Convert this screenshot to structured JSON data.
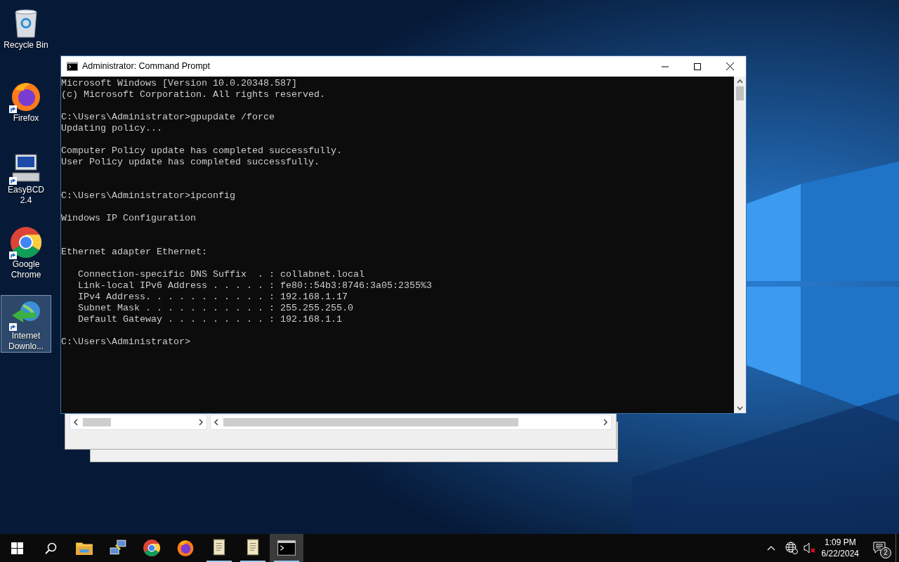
{
  "desktop_icons": [
    {
      "label": "Recycle Bin",
      "kind": "recycle",
      "selected": false,
      "shortcut": false
    },
    {
      "label": "Firefox",
      "kind": "firefox",
      "selected": false,
      "shortcut": true
    },
    {
      "label": "EasyBCD 2.4",
      "kind": "computer",
      "selected": false,
      "shortcut": true
    },
    {
      "label": "Google Chrome",
      "kind": "chrome",
      "selected": false,
      "shortcut": true
    },
    {
      "label": "Internet Downlo...",
      "kind": "globe",
      "selected": true,
      "shortcut": true
    }
  ],
  "window": {
    "title": "Administrator: Command Prompt",
    "console": [
      {
        "paragraphs": [
          [
            "Microsoft Windows [Version 10.0.20348.587]",
            "(c) Microsoft Corporation. All rights reserved."
          ],
          [
            "C:\\Users\\Administrator>gpupdate /force",
            "Updating policy..."
          ],
          [
            "Computer Policy update has completed successfully.",
            "User Policy update has completed successfully."
          ]
        ]
      },
      {
        "paragraphs": [
          [
            "C:\\Users\\Administrator>ipconfig"
          ],
          [
            "Windows IP Configuration"
          ]
        ]
      },
      {
        "paragraphs": [
          [
            "Ethernet adapter Ethernet:"
          ],
          [
            "   Connection-specific DNS Suffix  . : collabnet.local",
            "   Link-local IPv6 Address . . . . . : fe80::54b3:8746:3a05:2355%3",
            "   IPv4 Address. . . . . . . . . . . : 192.168.1.17",
            "   Subnet Mask . . . . . . . . . . . : 255.255.255.0",
            "   Default Gateway . . . . . . . . . : 192.168.1.1"
          ],
          [
            "C:\\Users\\Administrator>"
          ]
        ]
      }
    ]
  },
  "taskbar": {
    "apps": [
      {
        "kind": "folder",
        "active": false,
        "running": false
      },
      {
        "kind": "network",
        "active": false,
        "running": false
      },
      {
        "kind": "chrome",
        "active": false,
        "running": false
      },
      {
        "kind": "firefox",
        "active": false,
        "running": false
      },
      {
        "kind": "scroll",
        "active": false,
        "running": true
      },
      {
        "kind": "scroll",
        "active": false,
        "running": true
      },
      {
        "kind": "console",
        "active": true,
        "running": true
      }
    ],
    "time": "1:09 PM",
    "date": "6/22/2024",
    "notifications": "2"
  }
}
